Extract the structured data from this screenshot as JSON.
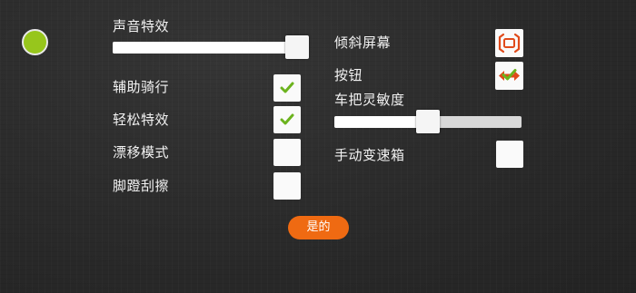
{
  "colors": {
    "status_dot": "#97c61c",
    "check": "#6cb31e",
    "accent": "#ef6a12",
    "icon_red": "#e04a1a"
  },
  "left": {
    "sound_label": "声音特效",
    "sound_volume": 0.95,
    "toggles": [
      {
        "label": "辅助骑行",
        "checked": true
      },
      {
        "label": "轻松特效",
        "checked": true
      },
      {
        "label": "漂移模式",
        "checked": false
      },
      {
        "label": "脚蹬刮擦",
        "checked": false
      }
    ]
  },
  "right": {
    "tilt_label": "倾斜屏幕",
    "tilt_icon": "tilt-screen-icon",
    "button_label": "按钮",
    "button_icon": "left-right-arrows-icon",
    "sensitivity_label": "车把灵敏度",
    "sensitivity_value": 0.5,
    "gearbox_label": "手动变速箱",
    "gearbox_checked": false
  },
  "confirm_label": "是的"
}
